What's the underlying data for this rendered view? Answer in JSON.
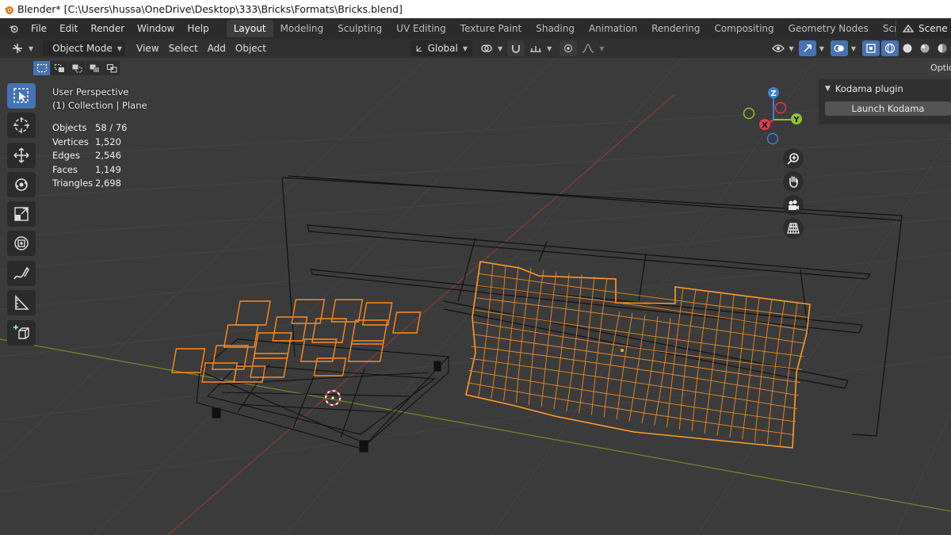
{
  "window": {
    "title": "Blender* [C:\\Users\\hussa\\OneDrive\\Desktop\\333\\Bricks\\Formats\\Bricks.blend]"
  },
  "menu": [
    "File",
    "Edit",
    "Render",
    "Window",
    "Help"
  ],
  "workspaces": [
    "Layout",
    "Modeling",
    "Sculpting",
    "UV Editing",
    "Texture Paint",
    "Shading",
    "Animation",
    "Rendering",
    "Compositing",
    "Geometry Nodes",
    "Scripting"
  ],
  "workspace_plus": "+",
  "scene": "Scene",
  "viewport_header": {
    "mode": "Object Mode",
    "menus": [
      "View",
      "Select",
      "Add",
      "Object"
    ],
    "orientation": "Global",
    "options_label": "Optic"
  },
  "overlay": {
    "view_name": "User Perspective",
    "collection": "(1) Collection | Plane"
  },
  "stats": [
    {
      "label": "Objects",
      "value": "58 / 76"
    },
    {
      "label": "Vertices",
      "value": "1,520"
    },
    {
      "label": "Edges",
      "value": "2,546"
    },
    {
      "label": "Faces",
      "value": "1,149"
    },
    {
      "label": "Triangles",
      "value": "2,698"
    }
  ],
  "gizmo": {
    "x": "X",
    "y": "Y",
    "z": "Z"
  },
  "npanel": {
    "title": "Kodama plugin",
    "button": "Launch Kodama"
  },
  "colors": {
    "accent": "#4772b3",
    "selection": "#ff8a1c",
    "x_axis": "#e0394f",
    "y_axis": "#8fc32b",
    "z_axis": "#3d7fd9"
  },
  "tools": [
    "select-box-icon",
    "cursor-icon",
    "move-icon",
    "rotate-icon",
    "scale-icon",
    "transform-icon",
    "annotate-icon",
    "measure-icon",
    "add-cube-icon"
  ]
}
